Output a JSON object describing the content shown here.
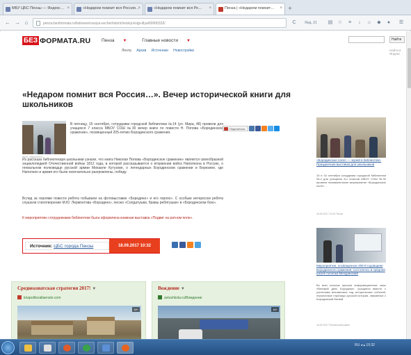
{
  "browser": {
    "tabs": [
      {
        "label": "МБУ ЦБС Пензы — Яндекс…",
        "active": false
      },
      {
        "label": "«Недаром помнит вся Россия…",
        "active": false
      },
      {
        "label": "«Недаром помнит вся Ро…",
        "active": false
      },
      {
        "label": "Пенза | «Недаром помнит…",
        "active": true
      }
    ],
    "new_tab_label": "+",
    "back_label": "←",
    "forward_label": "→",
    "url": "penza.bezformata.ru/listnews/rossiya-vecher/istoricheskoj-knigi-dlya/60000332/",
    "reload_label": "C",
    "search_engine_label": "Янд. 21"
  },
  "site": {
    "logo_bez": "БЕЗ",
    "logo_rest": "ФОРМАТА.RU",
    "nav": [
      {
        "label": "Пенза",
        "arrow": "▼"
      },
      {
        "label": "Главные новости",
        "arrow": "▼"
      }
    ],
    "subnav": [
      "Лента",
      "Архив",
      "Источники",
      "Новостройки"
    ],
    "search_button": "Найти",
    "search_link": "Найти в Яндекс"
  },
  "article": {
    "title": "«Недаром помнит вся Россия…». Вечер исторической книги для школьников",
    "photo_caption": "Фото: cbspenza.ru",
    "lead": "В пятницу, 15 сентября, сотрудники городской библиотеки №14 (ул. Мира, 48) провели для учащихся 7 класса МБОУ СОШ №30 вечер книги по повести Н. Попова «Бородинское сражение», посвященный 205-летию Бородинского сражения.",
    "lead_link": "«Бородинское сражение»",
    "paragraphs": [
      "Из рассказа библиотекаря школьники узнали, что книга Николая Попова «Бородинское сражение» является своеобразной энциклопедией Отечественной войны 1812 года, в которой рассказывается о вторжении войск Наполеона в Россию, о гениальном полководце русской армии Михаиле Кутузове, о легендарных Бородинском сражении и Березине, где Наполеон и армия его были окончательно разгромлены, победу.",
      "Вслед за героями повести ребята побывали на фотовыставке «Бородино» и его героях». С особым интересом ребята слушали стихотворение М.Ю. Лермонтова «Бородино», песню «Солдатушки, бравы ребятушки» в «Бородинском бою».",
      "К мероприятию сотрудниками библиотеки была оформлена книжная выставка «Подвиг на ратном поле»."
    ],
    "share_label": "Поделиться",
    "source_label": "Источник:",
    "source_name": "ЦБС города Пензы",
    "date": "18.09.2017  10:32"
  },
  "promos": [
    {
      "title": "Среднеазиатская стратегия 2017!",
      "chevron": "▼",
      "source": "kriapolitovallaenste.com",
      "badge": "18+"
    },
    {
      "title": "Вождение",
      "chevron": "▼",
      "source": "avtoshkola.ru/Вождение",
      "badge": "18+"
    }
  ],
  "sidebar": [
    {
      "caption": "«Бородинское поле» — музей в библиотеке. Праздничная выставка для школьников",
      "text": "15 и 16 сентября сотрудники городской библиотеки №4 для учащихся 8-х классов МБОУ СОШ №30 провели познавательное мероприятие «Бородинское поле»…",
      "meta": "18.09.2017 10:04 Пенза"
    },
    {
      "caption": "Мероприятие, посвященное 205-й годовщине Бородинского сражения, состоялось в средней школе поселка Мичуринский",
      "text": "Во всех классах прошли информационные часы «Великий день Бородина», учащиеся вместе с учителями вспоминали ход исторических событий, героические страницы русской истории, связанные с Бородинской битвой.",
      "meta": "18.09.2017 Пензенский район"
    }
  ],
  "taskbar": {
    "tray_text": "RU  ◂  ▴  10:32"
  },
  "colors": {
    "brand_red": "#d8141b",
    "source_date_bg": "#e8401e",
    "link_blue": "#2c5c9c",
    "promo_bg": "#e7f1df",
    "taskbar": "#2f5f95"
  }
}
